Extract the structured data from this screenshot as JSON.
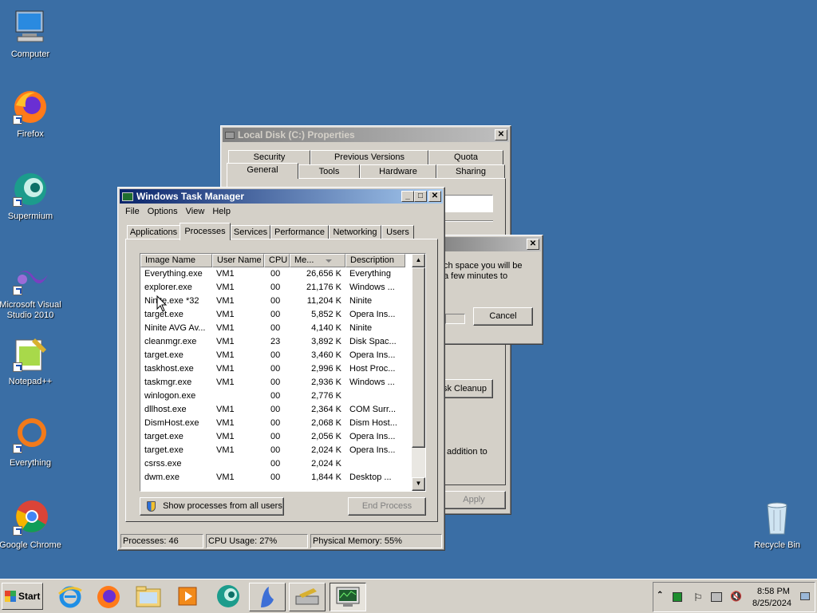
{
  "desktop": {
    "icons": [
      {
        "label": "Computer"
      },
      {
        "label": "Firefox"
      },
      {
        "label": "Supermium"
      },
      {
        "label": "Microsoft Visual Studio 2010"
      },
      {
        "label": "Notepad++"
      },
      {
        "label": "Everything"
      },
      {
        "label": "Google Chrome"
      },
      {
        "label": "Recycle Bin"
      }
    ]
  },
  "properties_window": {
    "title": "Local Disk (C:) Properties",
    "tabs_row1": [
      "Security",
      "Previous Versions",
      "Quota"
    ],
    "tabs_row2": [
      "General",
      "Tools",
      "Hardware",
      "Sharing"
    ],
    "apply_label": "Apply",
    "disk_cleanup_label": "sk Cleanup",
    "partial_text": "addition to"
  },
  "cleanup_dialog": {
    "text_line1": "ch space you will be",
    "text_line2": "a few minutes to",
    "cancel_label": "Cancel"
  },
  "task_manager": {
    "title": "Windows Task Manager",
    "menu": [
      "File",
      "Options",
      "View",
      "Help"
    ],
    "tabs": [
      "Applications",
      "Processes",
      "Services",
      "Performance",
      "Networking",
      "Users"
    ],
    "active_tab": "Processes",
    "columns": [
      "Image Name",
      "User Name",
      "CPU",
      "Me...",
      "Description"
    ],
    "rows": [
      {
        "name": "Everything.exe",
        "user": "VM1",
        "cpu": "00",
        "mem": "26,656 K",
        "desc": "Everything"
      },
      {
        "name": "explorer.exe",
        "user": "VM1",
        "cpu": "00",
        "mem": "21,176 K",
        "desc": "Windows ..."
      },
      {
        "name": "Ninite.exe *32",
        "user": "VM1",
        "cpu": "00",
        "mem": "11,204 K",
        "desc": "Ninite"
      },
      {
        "name": "target.exe",
        "user": "VM1",
        "cpu": "00",
        "mem": "5,852 K",
        "desc": "Opera Ins..."
      },
      {
        "name": "Ninite AVG Av...",
        "user": "VM1",
        "cpu": "00",
        "mem": "4,140 K",
        "desc": "Ninite"
      },
      {
        "name": "cleanmgr.exe",
        "user": "VM1",
        "cpu": "23",
        "mem": "3,892 K",
        "desc": "Disk Spac..."
      },
      {
        "name": "target.exe",
        "user": "VM1",
        "cpu": "00",
        "mem": "3,460 K",
        "desc": "Opera Ins..."
      },
      {
        "name": "taskhost.exe",
        "user": "VM1",
        "cpu": "00",
        "mem": "2,996 K",
        "desc": "Host Proc..."
      },
      {
        "name": "taskmgr.exe",
        "user": "VM1",
        "cpu": "00",
        "mem": "2,936 K",
        "desc": "Windows ..."
      },
      {
        "name": "winlogon.exe",
        "user": "",
        "cpu": "00",
        "mem": "2,776 K",
        "desc": ""
      },
      {
        "name": "dllhost.exe",
        "user": "VM1",
        "cpu": "00",
        "mem": "2,364 K",
        "desc": "COM Surr..."
      },
      {
        "name": "DismHost.exe",
        "user": "VM1",
        "cpu": "00",
        "mem": "2,068 K",
        "desc": "Dism Host..."
      },
      {
        "name": "target.exe",
        "user": "VM1",
        "cpu": "00",
        "mem": "2,056 K",
        "desc": "Opera Ins..."
      },
      {
        "name": "target.exe",
        "user": "VM1",
        "cpu": "00",
        "mem": "2,024 K",
        "desc": "Opera Ins..."
      },
      {
        "name": "csrss.exe",
        "user": "",
        "cpu": "00",
        "mem": "2,024 K",
        "desc": ""
      },
      {
        "name": "dwm.exe",
        "user": "VM1",
        "cpu": "00",
        "mem": "1,844 K",
        "desc": "Desktop ..."
      }
    ],
    "show_all_label": "Show processes from all users",
    "end_process_label": "End Process",
    "status": {
      "processes": "Processes: 46",
      "cpu": "CPU Usage: 27%",
      "memory": "Physical Memory: 55%"
    }
  },
  "taskbar": {
    "start_label": "Start",
    "clock_time": "8:58 PM",
    "clock_date": "8/25/2024"
  }
}
